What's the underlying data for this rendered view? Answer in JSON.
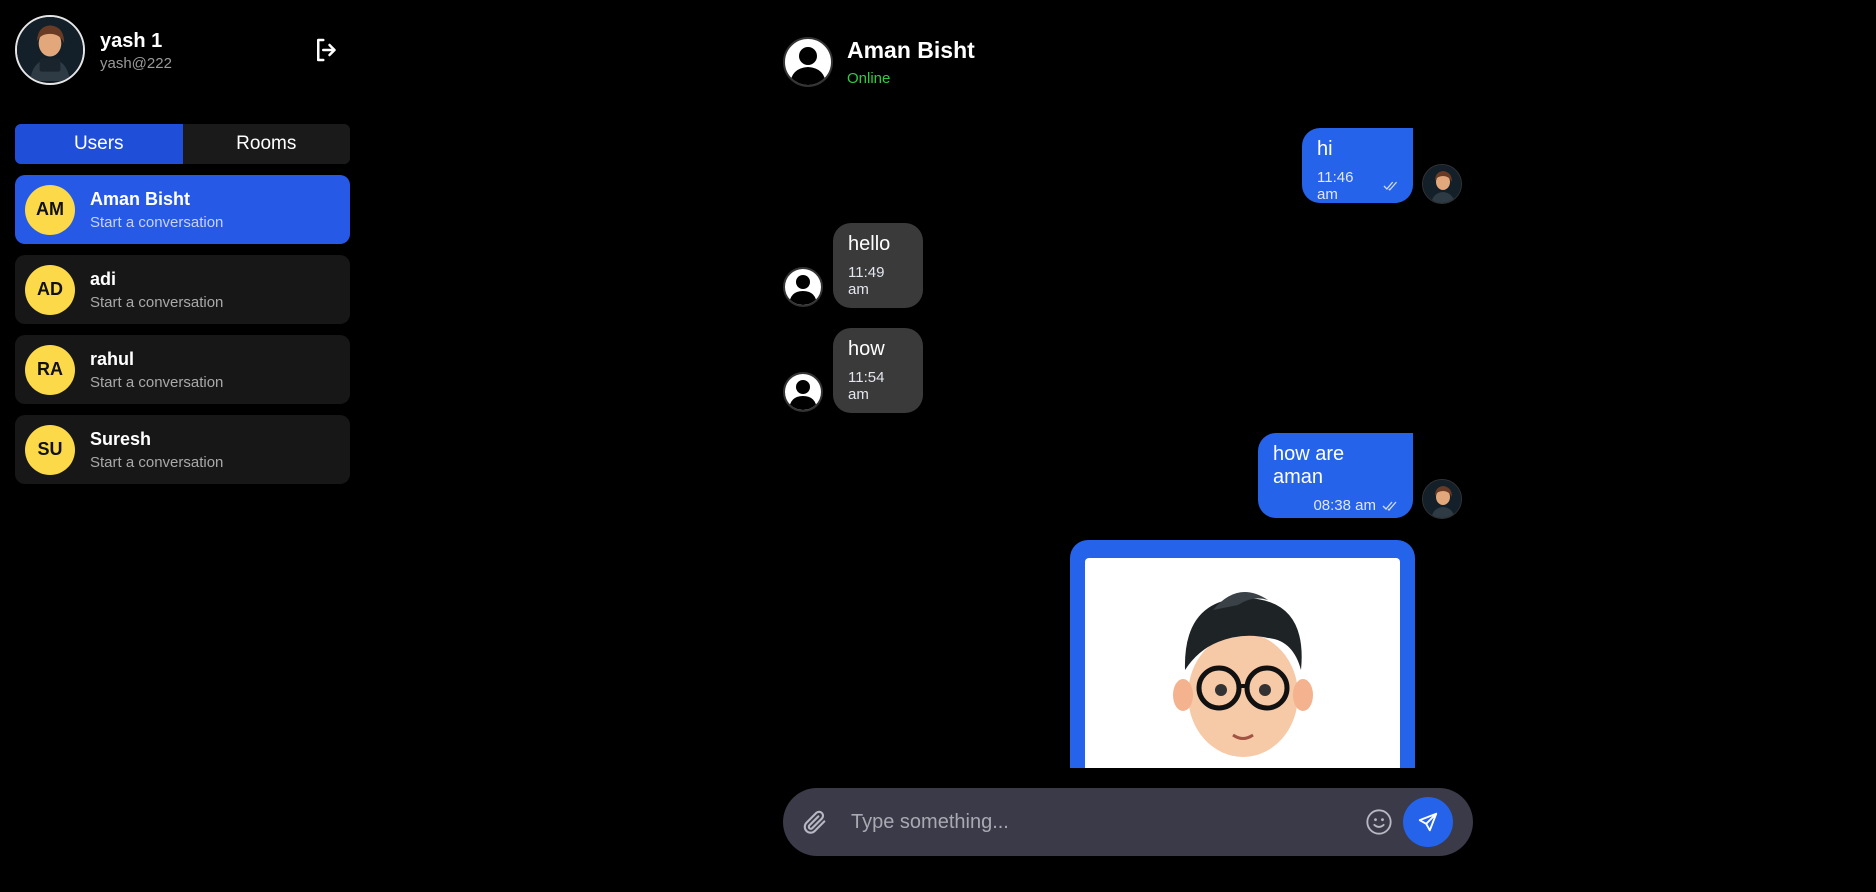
{
  "profile": {
    "name": "yash 1",
    "handle": "yash@222",
    "avatar_icon": "cartoon-hacker-avatar"
  },
  "tabs": {
    "users_label": "Users",
    "rooms_label": "Rooms",
    "active": "Users"
  },
  "users": [
    {
      "initials": "AM",
      "name": "Aman Bisht",
      "subtitle": "Start a conversation",
      "selected": true
    },
    {
      "initials": "AD",
      "name": "adi",
      "subtitle": "Start a conversation",
      "selected": false
    },
    {
      "initials": "RA",
      "name": "rahul",
      "subtitle": "Start a conversation",
      "selected": false
    },
    {
      "initials": "SU",
      "name": "Suresh",
      "subtitle": "Start a conversation",
      "selected": false
    }
  ],
  "chat": {
    "contact_name": "Aman Bisht",
    "status": "Online",
    "messages": [
      {
        "direction": "sent",
        "text": "hi",
        "time": "11:46 am",
        "read": true
      },
      {
        "direction": "received",
        "text": "hello",
        "time": "11:49 am"
      },
      {
        "direction": "received",
        "text": "how",
        "time": "11:54 am"
      },
      {
        "direction": "sent",
        "text": "how are aman",
        "time": "08:38 am",
        "read": true
      },
      {
        "direction": "sent",
        "type": "image",
        "image_icon": "cartoon-boy-with-glasses"
      }
    ]
  },
  "composer": {
    "placeholder": "Type something..."
  },
  "colors": {
    "accent": "#2563eb",
    "selected_user": "#2559e6",
    "received_bubble": "#3a3a3a",
    "initials_bg": "#fbd948",
    "online": "#2ecc40",
    "background": "#000000"
  }
}
